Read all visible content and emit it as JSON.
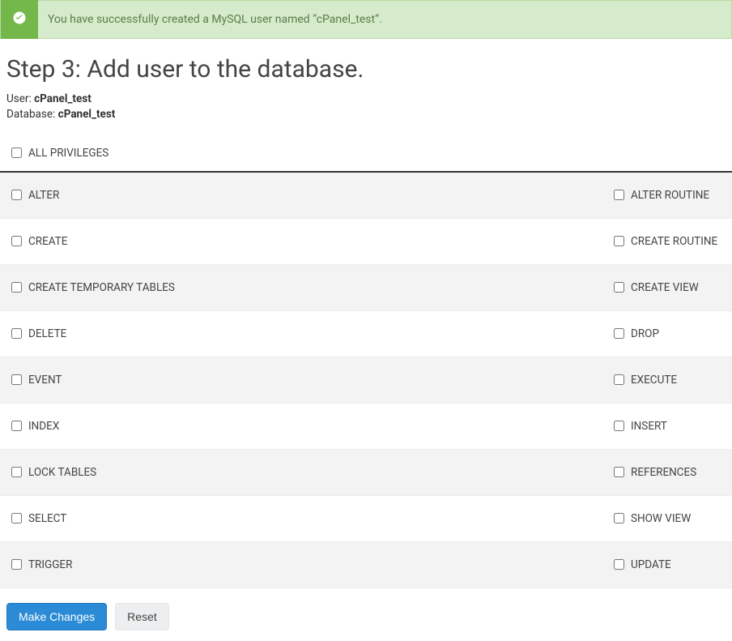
{
  "banner": {
    "message": "You have successfully created a MySQL user named “cPanel_test”."
  },
  "title": "Step 3: Add user to the database.",
  "meta": {
    "user_label": "User:",
    "user_value": "cPanel_test",
    "db_label": "Database:",
    "db_value": "cPanel_test"
  },
  "all_privileges_label": "ALL PRIVILEGES",
  "privileges": [
    {
      "left": "ALTER",
      "right": "ALTER ROUTINE"
    },
    {
      "left": "CREATE",
      "right": "CREATE ROUTINE"
    },
    {
      "left": "CREATE TEMPORARY TABLES",
      "right": "CREATE VIEW"
    },
    {
      "left": "DELETE",
      "right": "DROP"
    },
    {
      "left": "EVENT",
      "right": "EXECUTE"
    },
    {
      "left": "INDEX",
      "right": "INSERT"
    },
    {
      "left": "LOCK TABLES",
      "right": "REFERENCES"
    },
    {
      "left": "SELECT",
      "right": "SHOW VIEW"
    },
    {
      "left": "TRIGGER",
      "right": "UPDATE"
    }
  ],
  "buttons": {
    "make_changes": "Make Changes",
    "reset": "Reset"
  }
}
